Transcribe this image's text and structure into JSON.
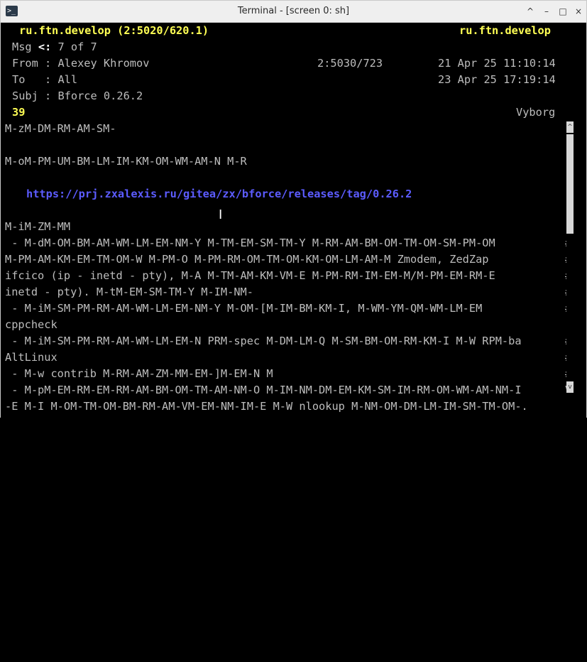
{
  "window": {
    "title": "Terminal - [screen 0: sh]",
    "app_icon_glyph": ">_",
    "controls": [
      "^",
      "–",
      "□",
      "×"
    ]
  },
  "header": {
    "area_left": "ru.ftn.develop (2:5020/620.1)",
    "area_right": "ru.ftn.develop",
    "msg_label": "Msg",
    "msg_arrow": "<:",
    "msg_value": "7 of 7",
    "from_label": "From : ",
    "from_name": "Alexey Khromov",
    "from_addr": "2:5030/723",
    "from_date": "21 Apr 25 11:10:14",
    "to_label": "To   : ",
    "to_name": "All",
    "to_date": "23 Apr 25 17:19:14",
    "subj_label": "Subj : ",
    "subj_value": "Bforce 0.26.2",
    "msgid_num": "39",
    "city": "Vyborg"
  },
  "body": {
    "lines": [
      "M-zM-DM-RM-AM-SM-",
      "",
      "M-oM-PM-UM-BM-LM-IM-KM-OM-WM-AM-N M-R",
      "",
      "",
      "",
      "M-iM-ZM-MM",
      " - M-dM-OM-BM-AM-WM-LM-EM-NM-Y M-TM-EM-SM-TM-Y M-RM-AM-BM-OM-TM-OM-SM-PM-OM",
      "M-PM-AM-KM-EM-TM-OM-W M-PM-O M-PM-RM-OM-TM-OM-KM-OM-LM-AM-M Zmodem, ZedZap",
      "ifcico (ip - inetd - pty), M-A M-TM-AM-KM-VM-E M-PM-RM-IM-EM-M/M-PM-EM-RM-E",
      "inetd - pty). M-tM-EM-SM-TM-Y M-IM-NM-",
      " - M-iM-SM-PM-RM-AM-WM-LM-EM-NM-Y M-OM-[M-IM-BM-KM-I, M-WM-YM-QM-WM-LM-EM",
      "cppcheck",
      " - M-iM-SM-PM-RM-AM-WM-LM-EM-N PRM-spec M-DM-LM-Q M-SM-BM-OM-RM-KM-I M-W RPM-ba",
      "AltLinux",
      " - M-w contrib M-RM-AM-ZM-MM-EM-]M-EM-N M",
      " - M-pM-EM-RM-EM-RM-AM-BM-OM-TM-AM-NM-O M-IM-NM-DM-EM-KM-SM-IM-RM-OM-WM-AM-NM-I",
      "-E M-I M-OM-TM-OM-BM-RM-AM-VM-EM-NM-IM-E M-W nlookup M-NM-OM-DM-LM-IM-SM-TM-OM-."
    ],
    "link": "https://prj.zxalexis.ru/gitea/zx/bforce/releases/tag/0.26.2",
    "wrap_marker": "#",
    "last_wrap_char": "V"
  },
  "scrollbar": {
    "up_glyph": "^",
    "down_glyph": "v"
  },
  "mouse_cursor_glyph": "I"
}
